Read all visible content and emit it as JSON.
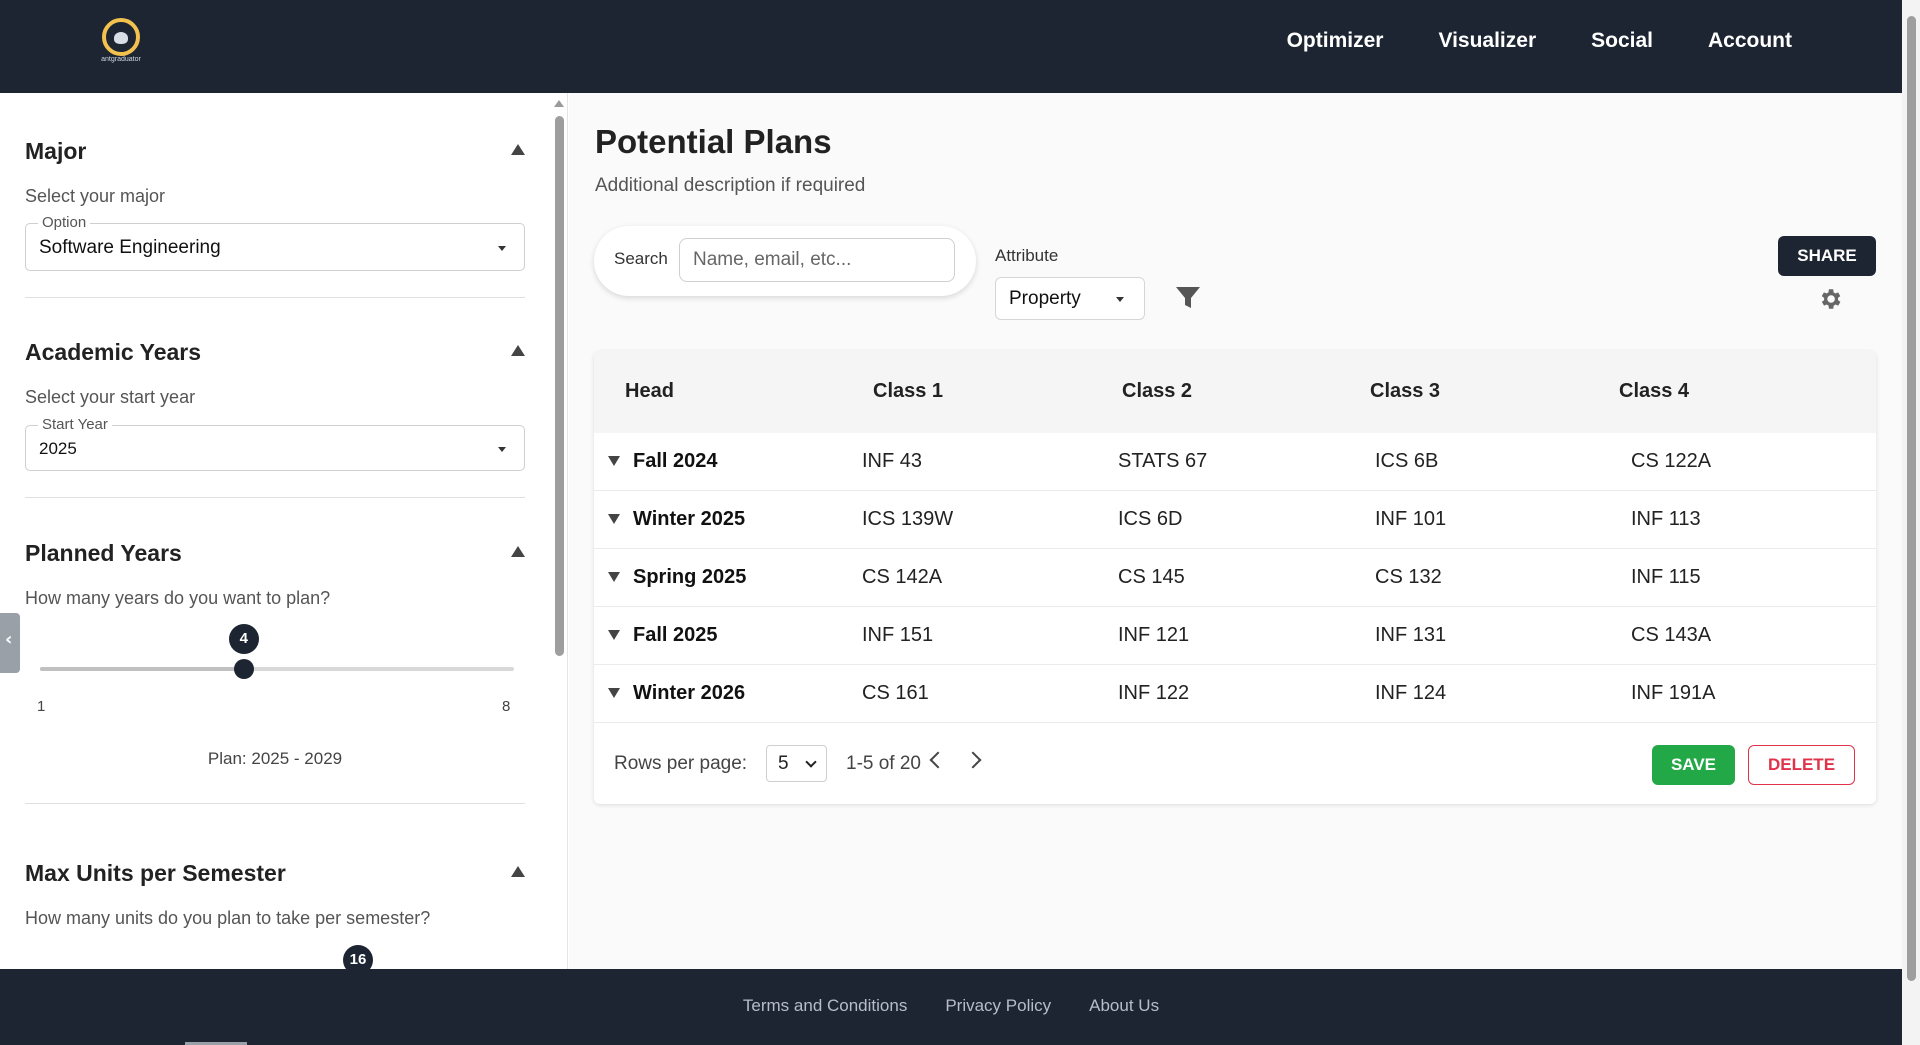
{
  "brand": {
    "logo_text": "antgraduator"
  },
  "nav": {
    "items": [
      "Optimizer",
      "Visualizer",
      "Social",
      "Account"
    ]
  },
  "sidebar": {
    "major": {
      "title": "Major",
      "desc": "Select your major",
      "field_label": "Option",
      "value": "Software Engineering"
    },
    "academic": {
      "title": "Academic Years",
      "desc": "Select your start year",
      "field_label": "Start Year",
      "value": "2025"
    },
    "planned": {
      "title": "Planned Years",
      "desc": "How many years do you want to plan?",
      "value": "4",
      "min": "1",
      "max": "8",
      "plan_range": "Plan: 2025 - 2029",
      "level": 0.43
    },
    "units": {
      "title": "Max Units per Semester",
      "desc": "How many units do you plan to take per semester?",
      "value": "16"
    }
  },
  "main": {
    "title": "Potential Plans",
    "subtitle": "Additional description if required",
    "search": {
      "label": "Search",
      "placeholder": "Name, email, etc..."
    },
    "attribute": {
      "label": "Attribute",
      "value": "Property"
    },
    "share_label": "SHARE",
    "table": {
      "headers": [
        "Head",
        "Class 1",
        "Class 2",
        "Class 3",
        "Class 4"
      ],
      "rows": [
        {
          "head": "Fall 2024",
          "cells": [
            "INF 43",
            "STATS 67",
            "ICS 6B",
            "CS 122A"
          ]
        },
        {
          "head": "Winter 2025",
          "cells": [
            "ICS 139W",
            "ICS 6D",
            "INF 101",
            "INF 113"
          ]
        },
        {
          "head": "Spring 2025",
          "cells": [
            "CS 142A",
            "CS 145",
            "CS 132",
            "INF 115"
          ]
        },
        {
          "head": "Fall 2025",
          "cells": [
            "INF 151",
            "INF 121",
            "INF 131",
            "CS 143A"
          ]
        },
        {
          "head": "Winter 2026",
          "cells": [
            "CS 161",
            "INF 122",
            "INF 124",
            "INF 191A"
          ]
        }
      ]
    },
    "pagination": {
      "rows_label": "Rows per page:",
      "rows_value": "5",
      "count": "1-5 of 20"
    },
    "save_label": "SAVE",
    "delete_label": "DELETE"
  },
  "footer": {
    "links": [
      "Terms and Conditions",
      "Privacy Policy",
      "About Us"
    ]
  },
  "colors": {
    "header_bg": "#1e2532",
    "save": "#22a846",
    "delete": "#e0334a"
  }
}
